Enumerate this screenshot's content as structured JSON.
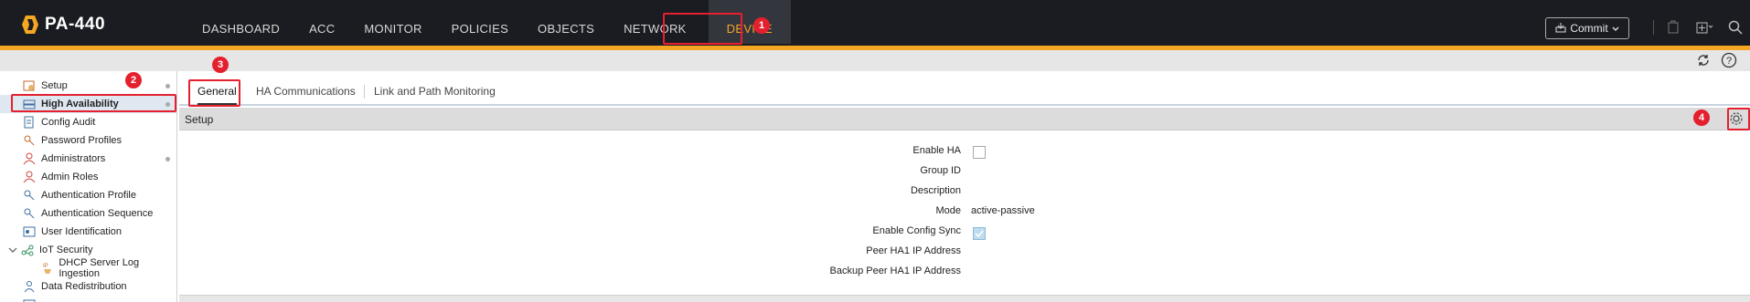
{
  "app": {
    "title": "PA-440"
  },
  "nav": {
    "items": [
      {
        "label": "DASHBOARD"
      },
      {
        "label": "ACC"
      },
      {
        "label": "MONITOR"
      },
      {
        "label": "POLICIES"
      },
      {
        "label": "OBJECTS"
      },
      {
        "label": "NETWORK"
      },
      {
        "label": "DEVICE",
        "active": true
      }
    ]
  },
  "toolbar": {
    "commit_label": "Commit"
  },
  "annotations": [
    "1",
    "2",
    "3",
    "4"
  ],
  "sidebar": {
    "items": [
      {
        "label": "Setup"
      },
      {
        "label": "High Availability",
        "active": true
      },
      {
        "label": "Config Audit"
      },
      {
        "label": "Password Profiles"
      },
      {
        "label": "Administrators"
      },
      {
        "label": "Admin Roles"
      },
      {
        "label": "Authentication Profile"
      },
      {
        "label": "Authentication Sequence"
      },
      {
        "label": "User Identification"
      },
      {
        "label": "IoT Security"
      },
      {
        "label": "DHCP Server Log Ingestion"
      },
      {
        "label": "Data Redistribution"
      }
    ]
  },
  "tabs": [
    {
      "label": "General",
      "active": true
    },
    {
      "label": "HA Communications"
    },
    {
      "label": "Link and Path Monitoring"
    }
  ],
  "panel": {
    "title": "Setup",
    "fields": [
      {
        "label": "Enable HA",
        "type": "checkbox",
        "checked": false
      },
      {
        "label": "Group ID",
        "value": ""
      },
      {
        "label": "Description",
        "value": ""
      },
      {
        "label": "Mode",
        "value": "active-passive"
      },
      {
        "label": "Enable Config Sync",
        "type": "checkbox",
        "checked": true
      },
      {
        "label": "Peer HA1 IP Address",
        "value": ""
      },
      {
        "label": "Backup Peer HA1 IP Address",
        "value": ""
      }
    ]
  },
  "colors": {
    "accent": "#f5a623",
    "topbar": "#1b1c21",
    "annotation": "#e5202e"
  }
}
